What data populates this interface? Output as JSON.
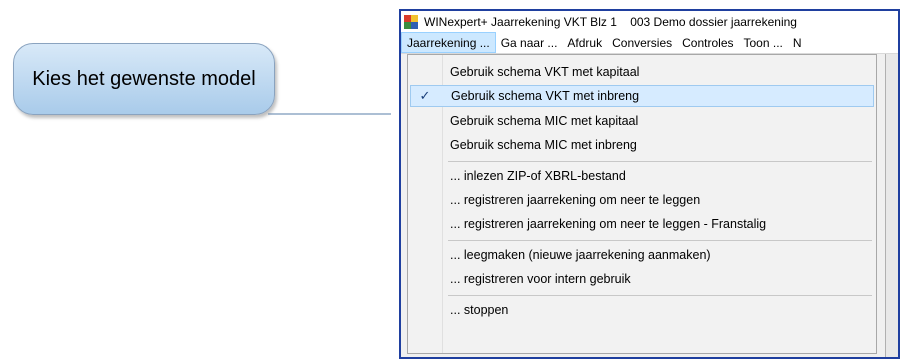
{
  "callout": {
    "text": "Kies het gewenste model"
  },
  "window": {
    "title": "WINexpert+ Jaarrekening VKT Blz 1    003 Demo dossier jaarrekening",
    "icon": "app-grid-icon"
  },
  "menubar": [
    "Jaarrekening ...",
    "Ga naar ...",
    "Afdruk",
    "Conversies",
    "Controles",
    "Toon ...",
    "N"
  ],
  "dropdown": {
    "groups": [
      [
        {
          "label": "Gebruik schema VKT met kapitaal",
          "checked": false
        },
        {
          "label": "Gebruik schema VKT met inbreng",
          "checked": true
        },
        {
          "label": "Gebruik schema MIC met kapitaal",
          "checked": false
        },
        {
          "label": "Gebruik schema MIC met inbreng",
          "checked": false
        }
      ],
      [
        {
          "label": "... inlezen ZIP-of XBRL-bestand",
          "checked": false
        },
        {
          "label": "... registreren jaarrekening om neer te leggen",
          "checked": false
        },
        {
          "label": "... registreren jaarrekening om neer te leggen - Franstalig",
          "checked": false
        }
      ],
      [
        {
          "label": "... leegmaken (nieuwe jaarrekening aanmaken)",
          "checked": false
        },
        {
          "label": "... registreren voor intern gebruik",
          "checked": false
        }
      ],
      [
        {
          "label": "... stoppen",
          "checked": false
        }
      ]
    ],
    "check_glyph": "✓"
  },
  "colors": {
    "frame_border": "#1f3f9f",
    "callout_fill": "#a9cbea",
    "highlight": "#d6ebff"
  }
}
